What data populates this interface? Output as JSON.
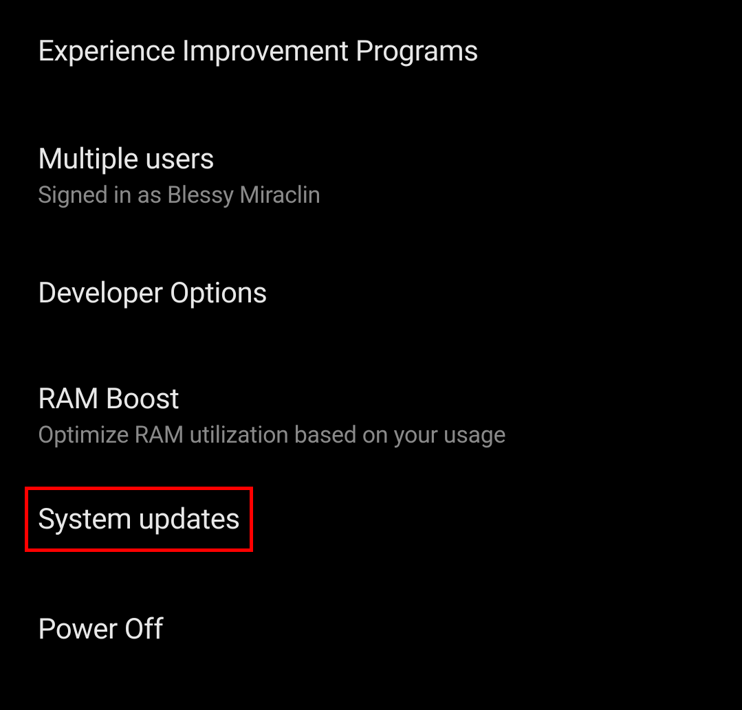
{
  "settings": {
    "items": [
      {
        "title": "Experience Improvement Programs",
        "subtitle": null
      },
      {
        "title": "Multiple users",
        "subtitle": "Signed in as Blessy Miraclin"
      },
      {
        "title": "Developer Options",
        "subtitle": null
      },
      {
        "title": "RAM Boost",
        "subtitle": "Optimize RAM utilization based on your usage"
      },
      {
        "title": "System updates",
        "subtitle": null
      },
      {
        "title": "Power Off",
        "subtitle": null
      }
    ]
  },
  "highlight_color": "#ff0000"
}
